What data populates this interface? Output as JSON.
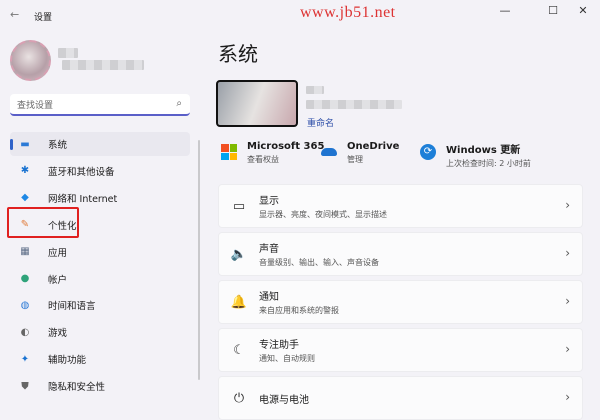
{
  "window": {
    "title": "设置",
    "watermark": "www.jb51.net",
    "minimize": "—",
    "maximize": "☐",
    "close": "✕"
  },
  "search": {
    "placeholder": "查找设置"
  },
  "sidebar": {
    "items": [
      {
        "label": "系统",
        "icon": "monitor-icon",
        "glyph": "▬",
        "color": "#2b7ad6"
      },
      {
        "label": "蓝牙和其他设备",
        "icon": "bluetooth-icon",
        "glyph": "✱",
        "color": "#1a73d1"
      },
      {
        "label": "网络和 Internet",
        "icon": "wifi-icon",
        "glyph": "◆",
        "color": "#1e88e5"
      },
      {
        "label": "个性化",
        "icon": "brush-icon",
        "glyph": "✎",
        "color": "#e07b39"
      },
      {
        "label": "应用",
        "icon": "apps-icon",
        "glyph": "▦",
        "color": "#5a6b85"
      },
      {
        "label": "帐户",
        "icon": "account-icon",
        "glyph": "●",
        "color": "#2fa37a"
      },
      {
        "label": "时间和语言",
        "icon": "globe-icon",
        "glyph": "◍",
        "color": "#2b7ad6"
      },
      {
        "label": "游戏",
        "icon": "game-icon",
        "glyph": "◐",
        "color": "#666"
      },
      {
        "label": "辅助功能",
        "icon": "accessibility-icon",
        "glyph": "✦",
        "color": "#1a73d1"
      },
      {
        "label": "隐私和安全性",
        "icon": "shield-icon",
        "glyph": "⛊",
        "color": "#666"
      }
    ]
  },
  "main": {
    "title": "系统",
    "rename": "重命名",
    "quick": [
      {
        "title": "Microsoft 365",
        "sub": "查看权益",
        "icon": "microsoft-logo-icon"
      },
      {
        "title": "OneDrive",
        "sub": "管理",
        "icon": "cloud-icon"
      },
      {
        "title": "Windows 更新",
        "sub": "上次检查时间: 2 小时前",
        "icon": "sync-icon"
      }
    ],
    "cards": [
      {
        "title": "显示",
        "sub": "显示器、亮度、夜间模式、显示描述",
        "icon": "laptop-icon",
        "glyph": "▭"
      },
      {
        "title": "声音",
        "sub": "音量级别、输出、输入、声音设备",
        "icon": "speaker-icon",
        "glyph": "🔈"
      },
      {
        "title": "通知",
        "sub": "来自应用和系统的警报",
        "icon": "bell-icon",
        "glyph": "🔔"
      },
      {
        "title": "专注助手",
        "sub": "通知、自动规则",
        "icon": "moon-icon",
        "glyph": "☾"
      },
      {
        "title": "电源与电池",
        "sub": "",
        "icon": "power-icon",
        "glyph": "⏻"
      }
    ]
  }
}
